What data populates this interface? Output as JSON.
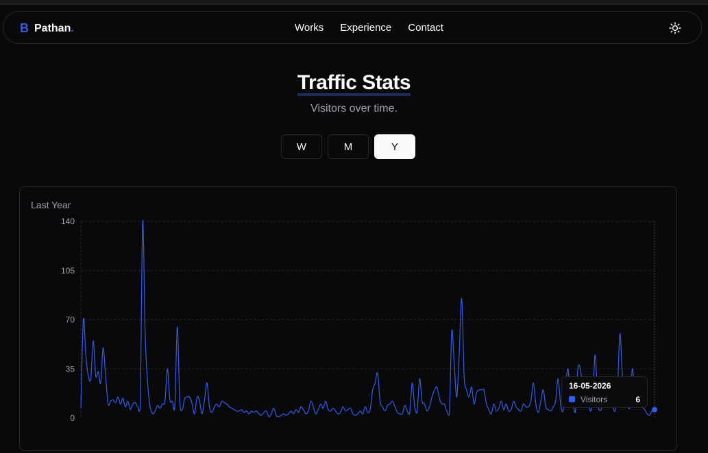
{
  "brand": {
    "mark": "B",
    "name": "Pathan",
    "dot": "."
  },
  "nav": [
    "Works",
    "Experience",
    "Contact"
  ],
  "theme_toggle_icon": "sun-icon",
  "page": {
    "title": "Traffic Stats",
    "subtitle": "Visitors over time."
  },
  "range_buttons": [
    {
      "label": "W",
      "active": false
    },
    {
      "label": "M",
      "active": false
    },
    {
      "label": "Y",
      "active": true
    }
  ],
  "card": {
    "title": "Last Year"
  },
  "tooltip": {
    "date": "16-05-2026",
    "label": "Visitors",
    "value": "6"
  },
  "colors": {
    "accent": "#2f5ff0",
    "background": "#09090b",
    "border": "#27272a"
  },
  "chart_data": {
    "type": "line",
    "title": "",
    "xlabel": "",
    "ylabel": "",
    "ylim": [
      0,
      140
    ],
    "yticks": [
      0,
      35,
      70,
      105,
      140
    ],
    "grid": true,
    "series": [
      {
        "values": [
          7,
          70,
          45,
          30,
          28,
          55,
          30,
          33,
          25,
          50,
          30,
          10,
          12,
          13,
          11,
          15,
          10,
          14,
          8,
          12,
          6,
          10,
          11,
          8,
          9,
          145,
          60,
          25,
          8,
          3,
          5,
          9,
          7,
          10,
          12,
          35,
          13,
          12,
          9,
          65,
          12,
          6,
          14,
          15,
          15,
          10,
          3,
          15,
          12,
          3,
          13,
          25,
          8,
          4,
          8,
          10,
          8,
          12,
          11,
          10,
          8,
          7,
          6,
          5,
          5,
          6,
          4,
          5,
          3,
          5,
          4,
          5,
          3,
          2,
          4,
          5,
          1,
          3,
          7,
          2,
          1,
          2,
          3,
          2,
          3,
          5,
          3,
          6,
          4,
          8,
          6,
          3,
          5,
          12,
          8,
          3,
          6,
          10,
          7,
          12,
          6,
          5,
          7,
          5,
          3,
          4,
          8,
          5,
          6,
          7,
          3,
          2,
          3,
          5,
          3,
          8,
          4,
          6,
          20,
          25,
          32,
          12,
          8,
          5,
          9,
          10,
          12,
          8,
          4,
          3,
          3,
          9,
          5,
          4,
          25,
          8,
          5,
          28,
          12,
          10,
          5,
          8,
          15,
          20,
          22,
          14,
          10,
          10,
          5,
          3,
          62,
          38,
          15,
          45,
          85,
          30,
          20,
          15,
          22,
          10,
          18,
          20,
          20,
          20,
          10,
          6,
          3,
          10,
          5,
          7,
          12,
          6,
          10,
          5,
          6,
          12,
          8,
          6,
          5,
          10,
          8,
          8,
          12,
          25,
          10,
          4,
          12,
          20,
          8,
          6,
          5,
          8,
          12,
          28,
          10,
          5,
          22,
          35,
          15,
          10,
          5,
          35,
          35,
          20,
          10,
          22,
          5,
          15,
          45,
          12,
          5,
          10,
          18,
          15,
          18,
          10,
          5,
          20,
          60,
          30,
          12,
          10,
          8,
          35,
          18,
          12,
          10,
          8,
          6,
          3,
          2,
          5,
          6
        ]
      }
    ]
  }
}
